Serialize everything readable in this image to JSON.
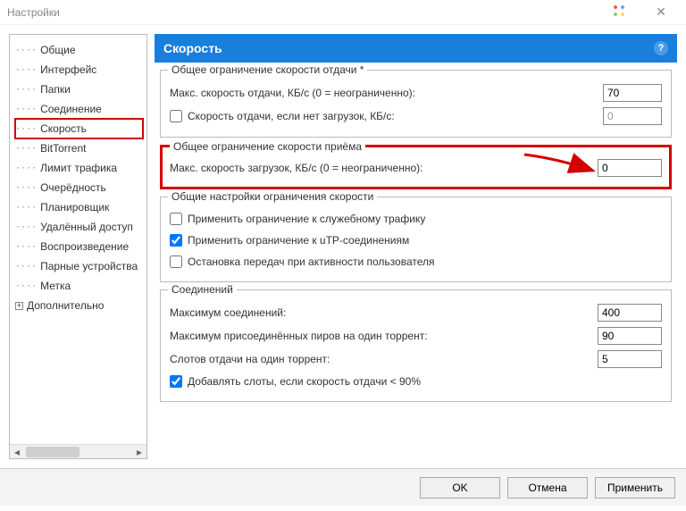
{
  "window": {
    "title": "Настройки"
  },
  "sidebar": {
    "items": [
      {
        "label": "Общие"
      },
      {
        "label": "Интерфейс"
      },
      {
        "label": "Папки"
      },
      {
        "label": "Соединение"
      },
      {
        "label": "Скорость",
        "selected": true
      },
      {
        "label": "BitTorrent"
      },
      {
        "label": "Лимит трафика"
      },
      {
        "label": "Очерёдность"
      },
      {
        "label": "Планировщик"
      },
      {
        "label": "Удалённый доступ"
      },
      {
        "label": "Воспроизведение"
      },
      {
        "label": "Парные устройства"
      },
      {
        "label": "Метка"
      },
      {
        "label": "Дополнительно",
        "expandable": true
      }
    ]
  },
  "header": {
    "title": "Скорость",
    "help": "?"
  },
  "upload_group": {
    "title": "Общее ограничение скорости отдачи *",
    "max_label": "Макс. скорость отдачи, КБ/с (0 = неограниченно):",
    "max_value": "70",
    "alt_label": "Скорость отдачи, если нет загрузок, КБ/с:",
    "alt_checked": false,
    "alt_value": "0"
  },
  "download_group": {
    "title": "Общее ограничение скорости приёма",
    "max_label": "Макс. скорость загрузок, КБ/с (0 = неограниченно):",
    "max_value": "0"
  },
  "general_group": {
    "title": "Общие настройки ограничения скорости",
    "cb1_label": "Применить ограничение к служебному трафику",
    "cb1_checked": false,
    "cb2_label": "Применить ограничение к uTP-соединениям",
    "cb2_checked": true,
    "cb3_label": "Остановка передач при активности пользователя",
    "cb3_checked": false
  },
  "conn_group": {
    "title": "Соединений",
    "row1_label": "Максимум соединений:",
    "row1_value": "400",
    "row2_label": "Максимум присоединённых пиров на один торрент:",
    "row2_value": "90",
    "row3_label": "Слотов отдачи на один торрент:",
    "row3_value": "5",
    "cb_label": "Добавлять слоты, если скорость отдачи < 90%",
    "cb_checked": true
  },
  "buttons": {
    "ok": "OK",
    "cancel": "Отмена",
    "apply": "Применить"
  }
}
